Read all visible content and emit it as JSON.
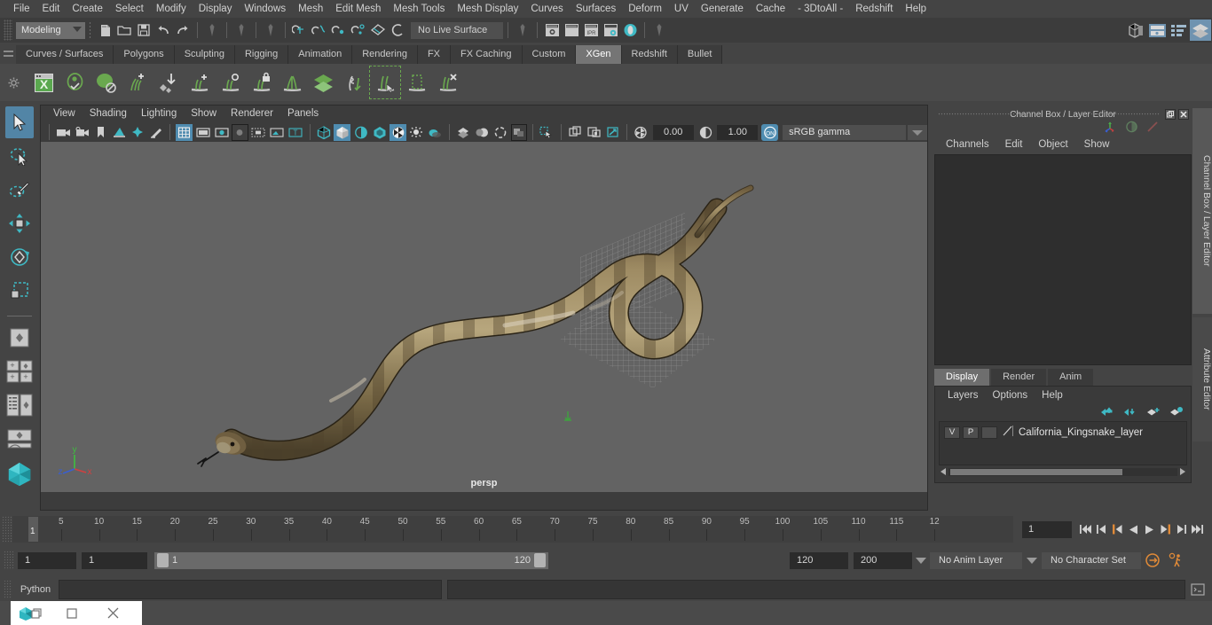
{
  "app": {
    "name": "Autodesk Maya"
  },
  "menubar": {
    "items": [
      "File",
      "Edit",
      "Create",
      "Select",
      "Modify",
      "Display",
      "Windows",
      "Mesh",
      "Edit Mesh",
      "Mesh Tools",
      "Mesh Display",
      "Curves",
      "Surfaces",
      "Deform",
      "UV",
      "Generate",
      "Cache",
      "- 3DtoAll -",
      "Redshift",
      "Help"
    ]
  },
  "statusline": {
    "menu_set": "Modeling",
    "live_surface": "No Live Surface",
    "icons": [
      "new-scene-icon",
      "open-scene-icon",
      "save-scene-icon",
      "undo-icon",
      "redo-icon",
      "select-by-hierarchy-icon",
      "select-by-object-icon",
      "select-by-component-icon",
      "snap-to-grid-icon",
      "snap-to-curve-icon",
      "snap-to-point-icon",
      "snap-to-projected-center-icon",
      "snap-to-view-plane-icon",
      "make-live-icon",
      "render-current-frame-icon",
      "ipr-render-icon",
      "render-settings-icon",
      "hypershade-icon",
      "render-view-icon",
      "outliner-icon",
      "node-editor-icon",
      "attribute-editor-toggle-icon",
      "channel-box-toggle-icon",
      "layer-editor-toggle-icon"
    ]
  },
  "shelf": {
    "tabs": [
      "Curves / Surfaces",
      "Polygons",
      "Sculpting",
      "Rigging",
      "Animation",
      "Rendering",
      "FX",
      "FX Caching",
      "Custom",
      "XGen",
      "Redshift",
      "Bullet"
    ],
    "active_tab": "XGen",
    "tools": [
      "xgen-editor-icon",
      "create-description-icon",
      "create-collection-icon",
      "add-groom-icon",
      "import-preset-icon",
      "add-density-modifier-icon",
      "add-noise-modifier-icon",
      "lock-modifier-icon",
      "clump-modifier-icon",
      "collection-layer-icon",
      "coil-modifier-icon",
      "guide-select-icon",
      "region-select-icon",
      "delete-guides-icon"
    ]
  },
  "toolbox": {
    "items": [
      "select-tool",
      "lasso-select-tool",
      "paint-select-tool",
      "move-tool",
      "rotate-tool",
      "scale-tool",
      "last-tool-used",
      "single-perspective-view",
      "four-view-layout",
      "persp-outliner-layout",
      "persp-graph-layout",
      "maya-logo"
    ],
    "selected": "select-tool"
  },
  "viewport": {
    "menus": [
      "View",
      "Shading",
      "Lighting",
      "Show",
      "Renderer",
      "Panels"
    ],
    "camera_label": "persp",
    "exposure": "0.00",
    "gamma": "1.00",
    "color_space": "sRGB gamma",
    "toolbar_icons": [
      "select-camera-icon",
      "bookmark-camera-icon",
      "camera-attributes-icon",
      "image-plane-icon",
      "two-d-pan-zoom-icon",
      "grid-toggle-icon",
      "film-gate-icon",
      "resolution-gate-icon",
      "gate-mask-icon",
      "field-chart-icon",
      "safe-action-icon",
      "safe-title-icon",
      "wireframe-icon",
      "smooth-shade-icon",
      "shaded-wireframe-icon",
      "use-default-material-icon",
      "textured-icon",
      "use-all-lights-icon",
      "shadows-icon",
      "screen-space-ao-icon",
      "motion-blur-icon",
      "multisample-icon",
      "isolate-select-icon",
      "xray-icon",
      "xray-joints-icon",
      "xray-active-components-icon",
      "exposure-icon",
      "gamma-icon",
      "color-management-icon"
    ],
    "axis": {
      "x": "x",
      "y": "y",
      "z": "z"
    },
    "model": "California Kingsnake 3D model"
  },
  "channel_box": {
    "dock_title": "Channel Box / Layer Editor",
    "menus": [
      "Channels",
      "Edit",
      "Object",
      "Show"
    ],
    "toolbar_icons": [
      "channel-box-icon",
      "attribute-editor-icon",
      "modeling-toolkit-icon"
    ]
  },
  "layer_editor": {
    "tabs": [
      "Display",
      "Render",
      "Anim"
    ],
    "active_tab": "Display",
    "menus": [
      "Layers",
      "Options",
      "Help"
    ],
    "tool_icons": [
      "move-layer-up-icon",
      "move-layer-down-icon",
      "create-empty-layer-icon",
      "create-layer-from-selection-icon"
    ],
    "layers": [
      {
        "visibility": "V",
        "playback": "P",
        "shading": "",
        "name": "California_Kingsnake_layer"
      }
    ]
  },
  "side_tabs": [
    {
      "label": "Channel Box / Layer Editor",
      "active": true
    },
    {
      "label": "Attribute Editor",
      "active": false
    }
  ],
  "time_slider": {
    "current_frame": "1",
    "frame_field": "1",
    "tick_labels": [
      "5",
      "10",
      "15",
      "20",
      "25",
      "30",
      "35",
      "40",
      "45",
      "50",
      "55",
      "60",
      "65",
      "70",
      "75",
      "80",
      "85",
      "90",
      "95",
      "100",
      "105",
      "110",
      "115",
      "12"
    ],
    "playback_icons": [
      "go-to-start-icon",
      "step-back-keyframe-icon",
      "step-back-frame-icon",
      "play-backwards-icon",
      "play-forwards-icon",
      "step-forward-frame-icon",
      "step-forward-keyframe-icon",
      "go-to-end-icon"
    ]
  },
  "range_slider": {
    "anim_start": "1",
    "range_start": "1",
    "range_start_label": "1",
    "range_end_label": "120",
    "range_end": "120",
    "anim_end": "200",
    "anim_layer": "No Anim Layer",
    "character_set": "No Character Set",
    "right_icons": [
      "auto-keyframe-icon",
      "animation-preferences-icon"
    ]
  },
  "command_line": {
    "language": "Python",
    "input_value": "",
    "placeholder": "",
    "result_value": "",
    "script_editor_icon": "script-editor-icon"
  },
  "taskbar": {
    "icons": [
      "maya-app-icon",
      "restore-window-icon",
      "maximize-window-icon",
      "close-window-icon"
    ]
  },
  "colors": {
    "accent_blue": "#5285a6",
    "teal": "#3fb9c4",
    "orange": "#e08a38",
    "shelf_green": "#6aa84f",
    "panel_bg": "#444444",
    "viewport_bg": "#636363"
  }
}
